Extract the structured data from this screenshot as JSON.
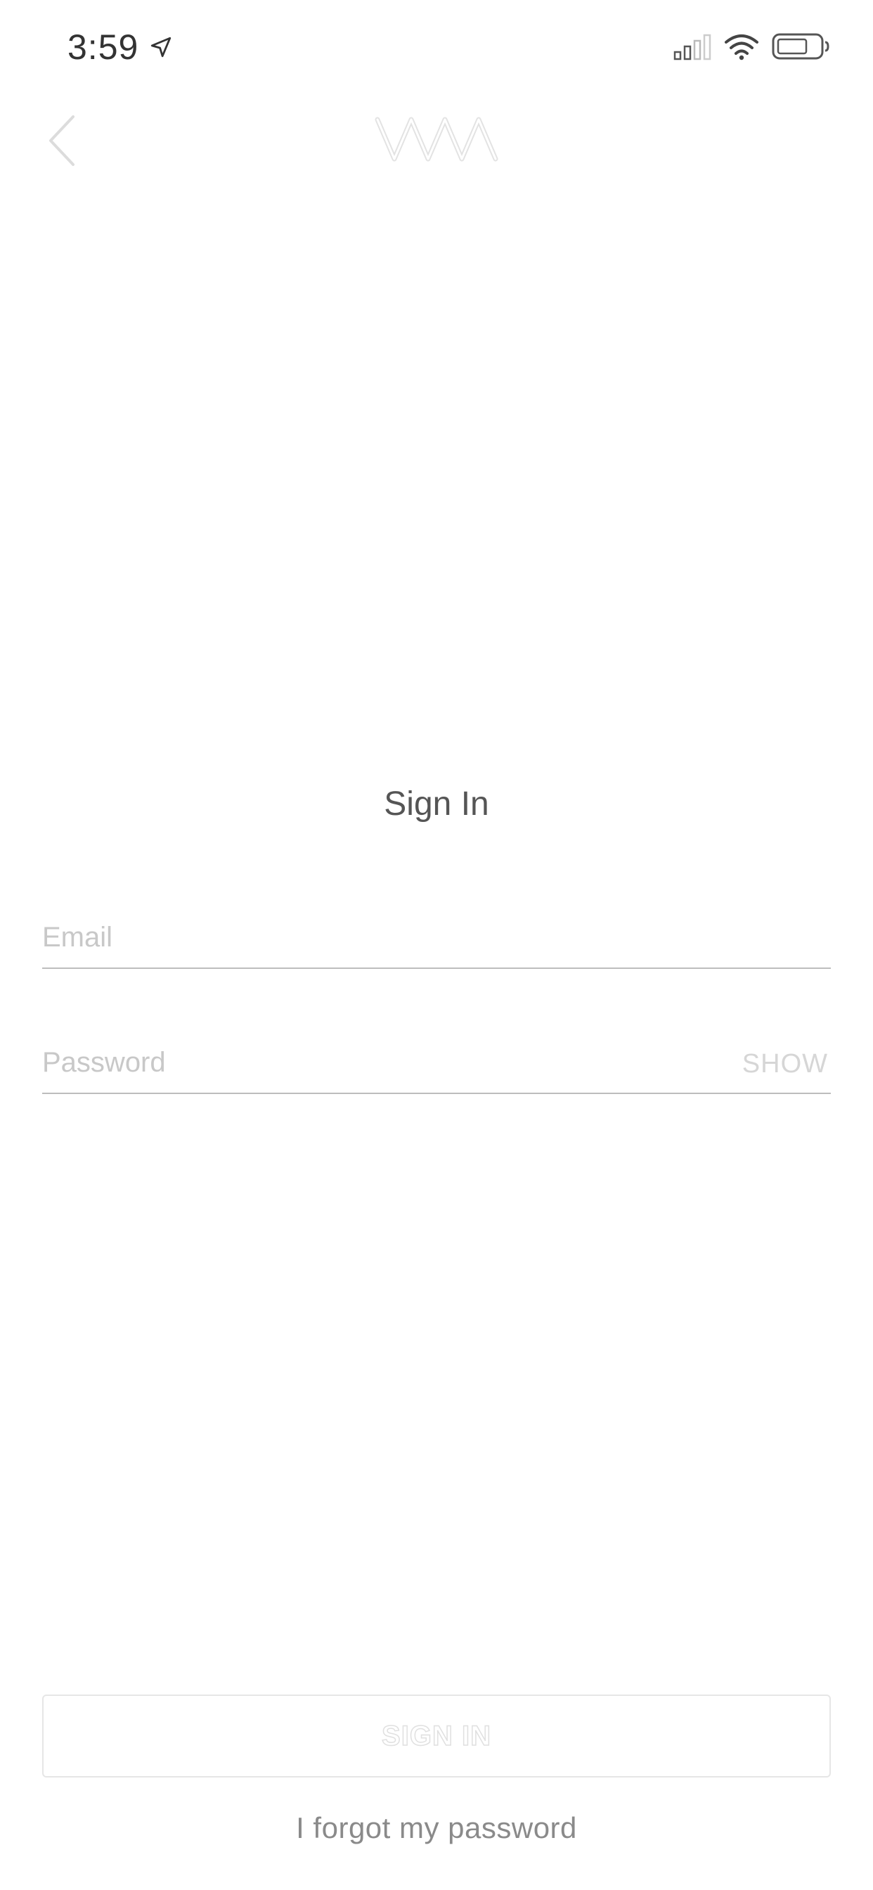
{
  "status_bar": {
    "time": "3:59",
    "icons": [
      "location-arrow-icon",
      "cellular-signal-icon",
      "wifi-icon",
      "battery-icon"
    ]
  },
  "nav": {
    "back_icon": "chevron-left-icon",
    "logo_icon": "wave-logo-icon"
  },
  "title": "Sign In",
  "form": {
    "email": {
      "value": "",
      "placeholder": "Email"
    },
    "password": {
      "value": "",
      "placeholder": "Password",
      "toggle_label": "SHOW"
    }
  },
  "actions": {
    "sign_in_label": "SIGN IN",
    "forgot_label": "I forgot my password"
  },
  "colors": {
    "text_primary": "#555555",
    "placeholder": "#c8c8c8",
    "underline": "#bdbdbd",
    "link": "#8a8a8a",
    "button_border": "#e6e6e6"
  }
}
